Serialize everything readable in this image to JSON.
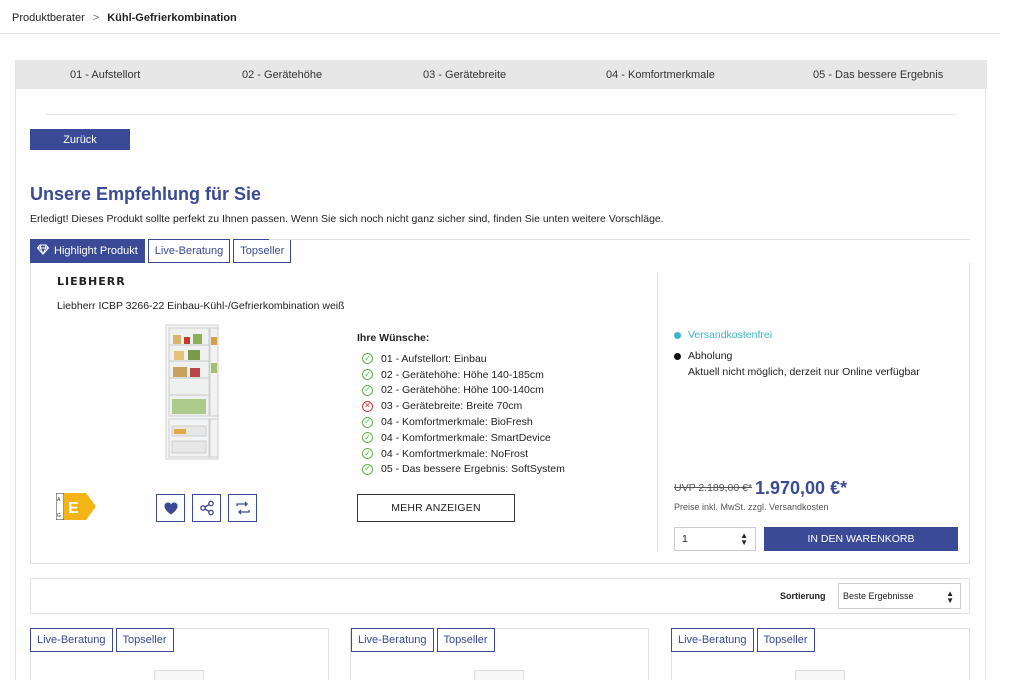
{
  "breadcrumb": {
    "root": "Produktberater",
    "separator": ">",
    "current": "Kühl-Gefrierkombination"
  },
  "steps": [
    "01 - Aufstellort",
    "02 - Gerätehöhe",
    "03 - Gerätebreite",
    "04 - Komfortmerkmale",
    "05 - Das bessere Ergebnis"
  ],
  "back_label": "Zurück",
  "recommendation": {
    "heading": "Unsere Empfehlung für Sie",
    "subtext": "Erledigt! Dieses Produkt sollte perfekt zu Ihnen passen. Wenn Sie sich noch nicht ganz sicher sind, finden Sie unten weitere Vorschläge."
  },
  "tabs": {
    "highlight": "Highlight Produkt",
    "live": "Live-Beratung",
    "top": "Topseller"
  },
  "product": {
    "brand": "LIEBHERR",
    "name": "Liebherr ICBP 3266-22 Einbau-Kühl-/Gefrierkombination weiß",
    "energy_class": "E",
    "energy_scale": "A G",
    "icons": [
      "heart-icon",
      "share-icon",
      "compare-icon"
    ],
    "more_label": "MEHR ANZEIGEN"
  },
  "wishes": {
    "title": "Ihre Wünsche:",
    "items": [
      {
        "text": "01 - Aufstellort: Einbau",
        "ok": true
      },
      {
        "text": "02 - Gerätehöhe: Höhe 140-185cm",
        "ok": true
      },
      {
        "text": "02 - Gerätehöhe: Höhe 100-140cm",
        "ok": true
      },
      {
        "text": "03 - Gerätebreite: Breite 70cm",
        "ok": false
      },
      {
        "text": "04 - Komfortmerkmale: BioFresh",
        "ok": true
      },
      {
        "text": "04 - Komfortmerkmale: SmartDevice",
        "ok": true
      },
      {
        "text": "04 - Komfortmerkmale: NoFrost",
        "ok": true
      },
      {
        "text": "05 - Das bessere Ergebnis: SoftSystem",
        "ok": true
      }
    ]
  },
  "shipping": {
    "free": "Versandkostenfrei",
    "pickup": "Abholung",
    "pickup_note": "Aktuell nicht möglich, derzeit nur Online verfügbar"
  },
  "pricing": {
    "uvp": "UVP 2.189,00 €*",
    "price": "1.970,00 €*",
    "vat_note": "Preise inkl. MwSt. zzgl. Versandkosten",
    "quantity": "1",
    "cart_label": "IN DEN WARENKORB"
  },
  "sorting": {
    "label": "Sortierung",
    "selected": "Beste Ergebnisse"
  },
  "colors": {
    "accent": "#3a4a96",
    "teal": "#3bb5c6",
    "ok": "#5fb248",
    "error": "#d23b3b",
    "energy": "#f2b417"
  }
}
